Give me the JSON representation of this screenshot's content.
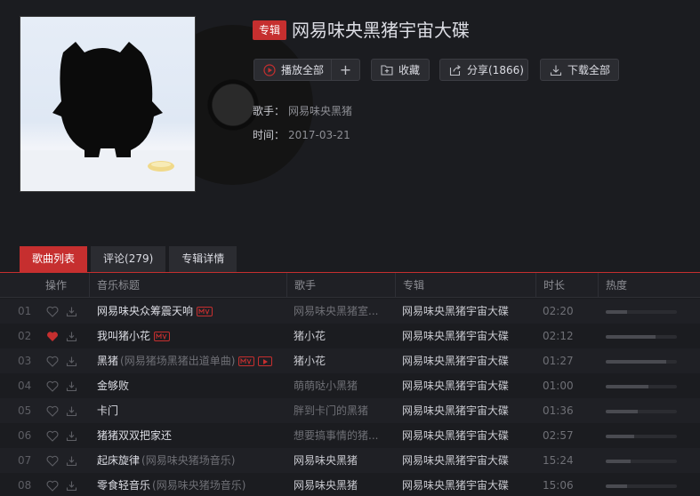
{
  "album": {
    "type_label": "专辑",
    "title": "网易味央黑猪宇宙大碟",
    "artist_label": "歌手：",
    "artist": "网易味央黑猪",
    "time_label": "时间：",
    "date": "2017-03-21"
  },
  "actions": {
    "play_all": "播放全部",
    "add": "+",
    "collect": "收藏",
    "share": "分享(1866)",
    "download_all": "下载全部"
  },
  "tabs": [
    "歌曲列表",
    "评论(279)",
    "专辑详情"
  ],
  "columns": {
    "ops": "操作",
    "title": "音乐标题",
    "artist": "歌手",
    "album": "专辑",
    "duration": "时长",
    "heat": "热度"
  },
  "accent": "#c62f2f",
  "songs": [
    {
      "idx": "01",
      "title": "网易味央众筹震天响",
      "sub": "",
      "mv": true,
      "play": false,
      "liked": false,
      "artist": "网易味央黑猪室...",
      "artist_dim": true,
      "album": "网易味央黑猪宇宙大碟",
      "duration": "02:20",
      "heat": 0.3
    },
    {
      "idx": "02",
      "title": "我叫猪小花",
      "sub": "",
      "mv": true,
      "play": false,
      "liked": true,
      "artist": "猪小花",
      "artist_dim": false,
      "album": "网易味央黑猪宇宙大碟",
      "duration": "02:12",
      "heat": 0.7
    },
    {
      "idx": "03",
      "title": "黑猪",
      "sub": "(网易猪场黑猪出道单曲)",
      "mv": true,
      "play": true,
      "liked": false,
      "artist": "猪小花",
      "artist_dim": false,
      "album": "网易味央黑猪宇宙大碟",
      "duration": "01:27",
      "heat": 0.85
    },
    {
      "idx": "04",
      "title": "金够败",
      "sub": "",
      "mv": false,
      "play": false,
      "liked": false,
      "artist": "萌萌哒小黑猪",
      "artist_dim": true,
      "album": "网易味央黑猪宇宙大碟",
      "duration": "01:00",
      "heat": 0.6
    },
    {
      "idx": "05",
      "title": "卡门",
      "sub": "",
      "mv": false,
      "play": false,
      "liked": false,
      "artist": "胖到卡门的黑猪",
      "artist_dim": true,
      "album": "网易味央黑猪宇宙大碟",
      "duration": "01:36",
      "heat": 0.45
    },
    {
      "idx": "06",
      "title": "猪猪双双把家还",
      "sub": "",
      "mv": false,
      "play": false,
      "liked": false,
      "artist": "想要搞事情的猪...",
      "artist_dim": true,
      "album": "网易味央黑猪宇宙大碟",
      "duration": "02:57",
      "heat": 0.4
    },
    {
      "idx": "07",
      "title": "起床旋律",
      "sub": "(网易味央猪场音乐)",
      "mv": false,
      "play": false,
      "liked": false,
      "artist": "网易味央黑猪",
      "artist_dim": false,
      "album": "网易味央黑猪宇宙大碟",
      "duration": "15:24",
      "heat": 0.35
    },
    {
      "idx": "08",
      "title": "零食轻音乐",
      "sub": "(网易味央猪场音乐)",
      "mv": false,
      "play": false,
      "liked": false,
      "artist": "网易味央黑猪",
      "artist_dim": false,
      "album": "网易味央黑猪宇宙大碟",
      "duration": "15:06",
      "heat": 0.3
    }
  ]
}
